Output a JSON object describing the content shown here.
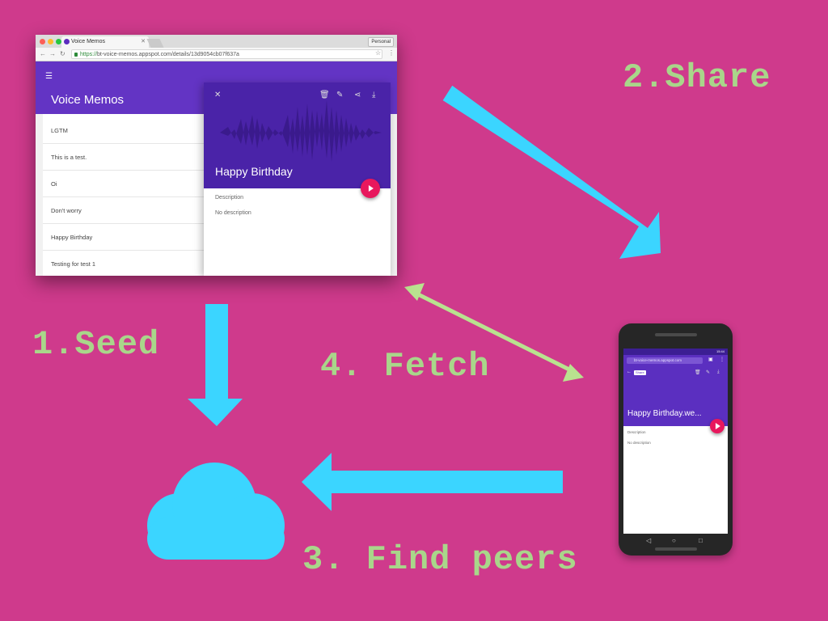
{
  "steps": {
    "seed": "1.Seed",
    "share": "2.Share",
    "find_peers": "3. Find peers",
    "fetch": "4. Fetch"
  },
  "colors": {
    "background": "#cf3a8c",
    "arrow": "#3bd5ff",
    "step_text": "#a9d68a",
    "fetch_arrow": "#b9e28f",
    "app_purple": "#6334c4",
    "accent_pink": "#e8175d"
  },
  "desktop": {
    "tab_title": "Voice Memos",
    "profile_label": "Personal",
    "url_scheme": "https://",
    "url_rest": "bt-voice-memos.appspot.com/details/13d9054cb07f637a",
    "app_title": "Voice Memos",
    "memos": [
      "LGTM",
      "This is a test.",
      "Oi",
      "Don't worry",
      "Happy Birthday",
      "Testing for test 1"
    ],
    "detail": {
      "title": "Happy Birthday",
      "description_label": "Description",
      "description_value": "No description"
    }
  },
  "mobile": {
    "time": "15:44",
    "url": "bt-voice-memos.appspot.com",
    "share_chip": "Share",
    "title": "Happy Birthday.we...",
    "description_label": "Description",
    "description_value": "No description"
  },
  "icons": [
    "close-icon",
    "delete-icon",
    "edit-icon",
    "share-icon",
    "download-icon",
    "play-icon",
    "cloud-icon",
    "menu-icon"
  ]
}
